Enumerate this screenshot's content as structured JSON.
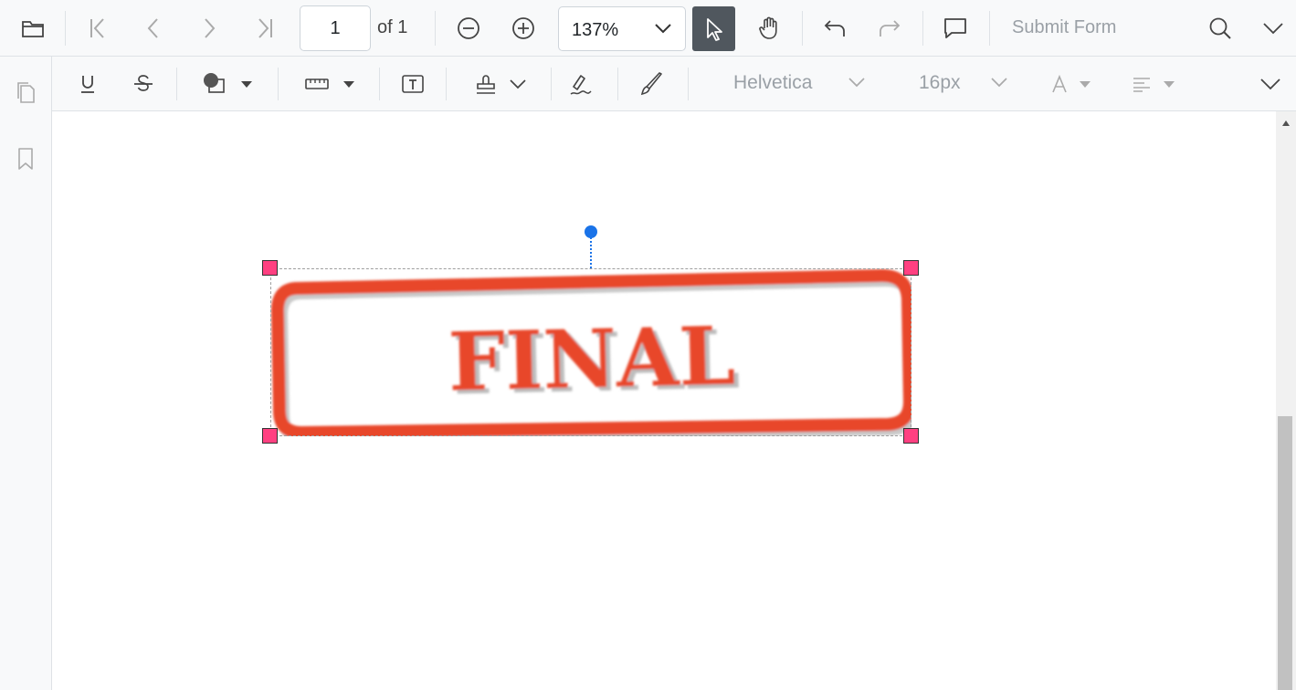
{
  "toolbar": {
    "current_page": "1",
    "of_label": "of 1",
    "zoom": "137%",
    "submit_form_label": "Submit Form",
    "icons": [
      "open-file-icon",
      "first-page-icon",
      "previous-page-icon",
      "next-page-icon",
      "last-page-icon",
      "zoom-out-icon",
      "zoom-in-icon",
      "selection-cursor-icon",
      "pan-hand-icon",
      "undo-icon",
      "redo-icon",
      "comment-icon",
      "search-icon",
      "chevron-down-icon"
    ]
  },
  "annotation_toolbar": {
    "font_family": "Helvetica",
    "font_size": "16px",
    "icons": [
      "underline-icon",
      "strikethrough-icon",
      "shape-icon",
      "measure-icon",
      "free-text-icon",
      "stamp-icon",
      "signature-icon",
      "ink-icon",
      "font-color-icon",
      "text-align-icon"
    ]
  },
  "left_nav": {
    "icons": [
      "page-thumbnails-icon",
      "bookmark-icon"
    ]
  },
  "document": {
    "stamp_text": "FINAL",
    "stamp_color": "#e8462b"
  },
  "colors": {
    "toolbar_bg": "#f8f9fa",
    "active_tool_bg": "#50575e",
    "handle": "#ff4081",
    "rotation_handle": "#1a73e8"
  }
}
